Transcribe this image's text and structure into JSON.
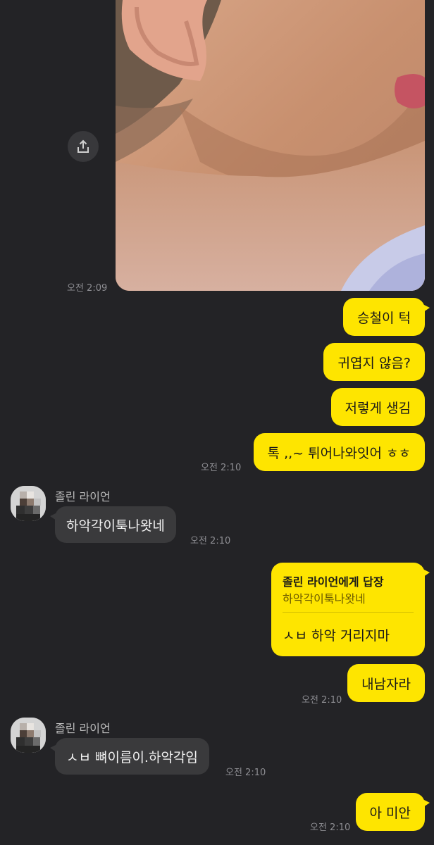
{
  "messages": {
    "photo_time": "오전 2:09",
    "me_1": "승철이 턱",
    "me_2": "귀엽지 않음?",
    "me_3": "저렇게 생김",
    "me_4": "톡 ,,~ 튀어나와잇어 ㅎㅎ",
    "me_group_1_time": "오전 2:10",
    "sender_1": "졸린 라이언",
    "them_1": "하악각이툭나왓네",
    "them_1_time": "오전 2:10",
    "reply_to": "졸린 라이언에게 답장",
    "reply_quote": "하악각이툭나왓네",
    "reply_body": "ㅅㅂ 하악 거리지마",
    "me_5": "내남자라",
    "me_group_2_time": "오전 2:10",
    "sender_2": "졸린 라이언",
    "them_2": "ㅅㅂ 뼈이름이.하악각임",
    "them_2_time": "오전 2:10",
    "me_6": "아 미안",
    "me_6_time": "오전 2:10"
  },
  "icons": {
    "share": "share-icon"
  },
  "colors": {
    "background": "#232326",
    "my_bubble": "#fee500",
    "their_bubble": "#3a3a3c"
  }
}
